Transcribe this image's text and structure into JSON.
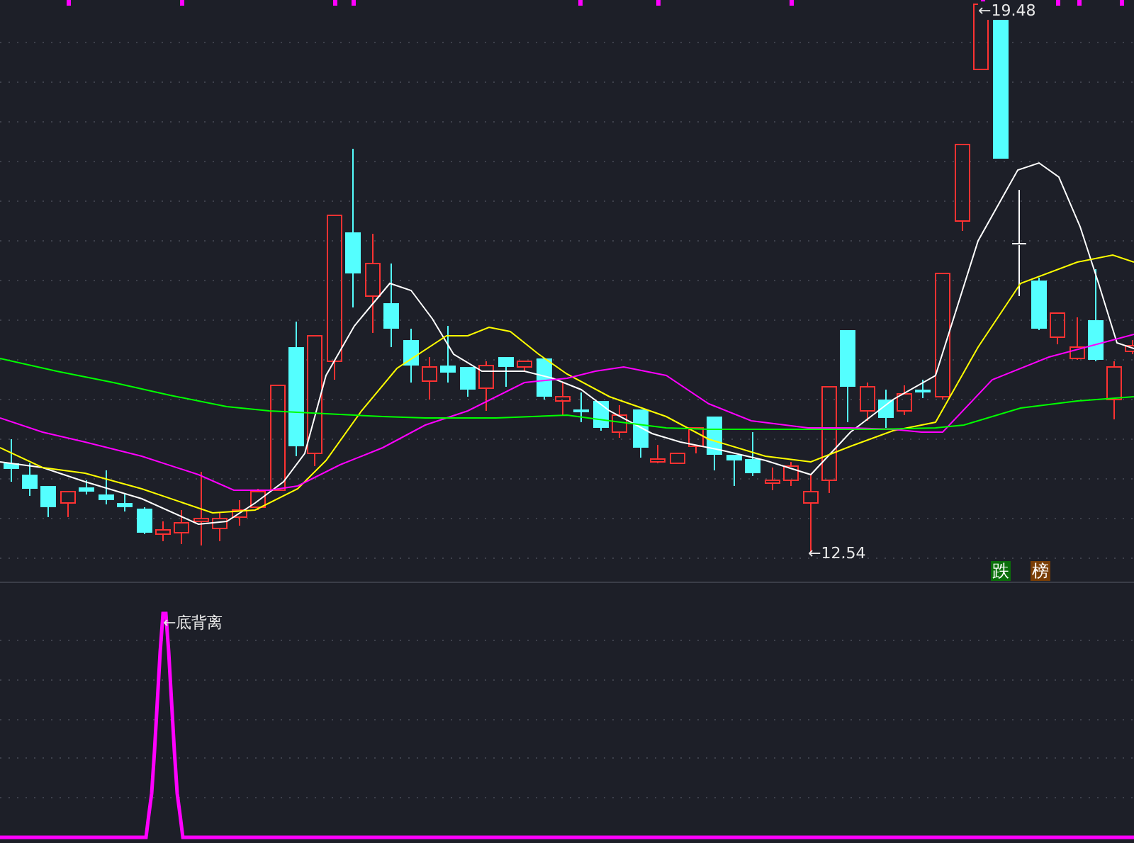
{
  "price_chart": {
    "high_label": "←19.48",
    "low_label": "←12.54",
    "badges": [
      {
        "text": "跌",
        "color": "#0a6e0a"
      },
      {
        "text": "榜",
        "color": "#7a3e06"
      }
    ]
  },
  "indicator_chart": {
    "signal_label": "←底背离"
  }
}
